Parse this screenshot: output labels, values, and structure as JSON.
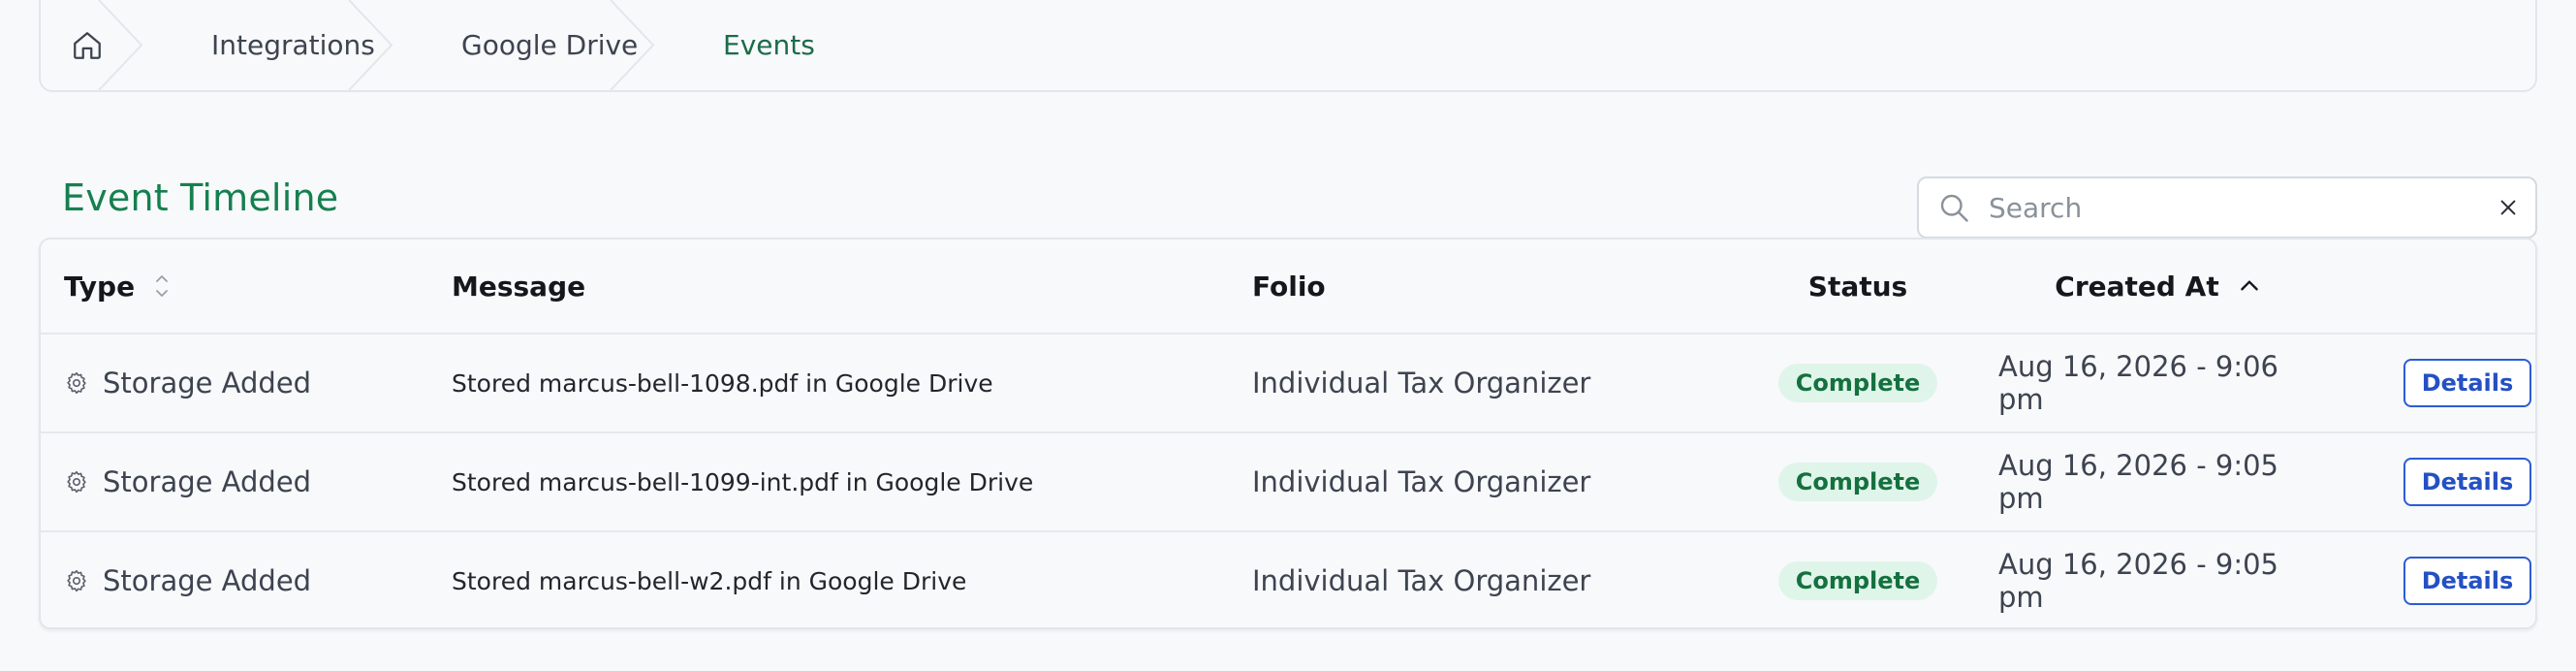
{
  "breadcrumb": {
    "home_icon": "home-icon",
    "items": [
      {
        "label": "Integrations"
      },
      {
        "label": "Google Drive"
      },
      {
        "label": "Events"
      }
    ]
  },
  "page": {
    "title": "Event Timeline"
  },
  "search": {
    "placeholder": "Search",
    "value": "",
    "icon": "search-icon",
    "clear_icon": "close-icon"
  },
  "table": {
    "columns": {
      "type": "Type",
      "message": "Message",
      "folio": "Folio",
      "status": "Status",
      "created_at": "Created At"
    },
    "sort": {
      "column": "created_at",
      "direction": "ascending"
    },
    "rows": [
      {
        "type": "Storage Added",
        "message": "Stored marcus-bell-1098.pdf in Google Drive",
        "folio": "Individual Tax Organizer",
        "status": "Complete",
        "created_at": "Aug 16, 2026 - 9:06 pm",
        "action": "Details"
      },
      {
        "type": "Storage Added",
        "message": "Stored marcus-bell-1099-int.pdf in Google Drive",
        "folio": "Individual Tax Organizer",
        "status": "Complete",
        "created_at": "Aug 16, 2026 - 9:05 pm",
        "action": "Details"
      },
      {
        "type": "Storage Added",
        "message": "Stored marcus-bell-w2.pdf in Google Drive",
        "folio": "Individual Tax Organizer",
        "status": "Complete",
        "created_at": "Aug 16, 2026 - 9:05 pm",
        "action": "Details"
      }
    ]
  },
  "colors": {
    "accent": "#15804f",
    "status_complete_bg": "#dff5ea",
    "status_complete_text": "#15703f",
    "button_border": "#2b5cd6"
  }
}
